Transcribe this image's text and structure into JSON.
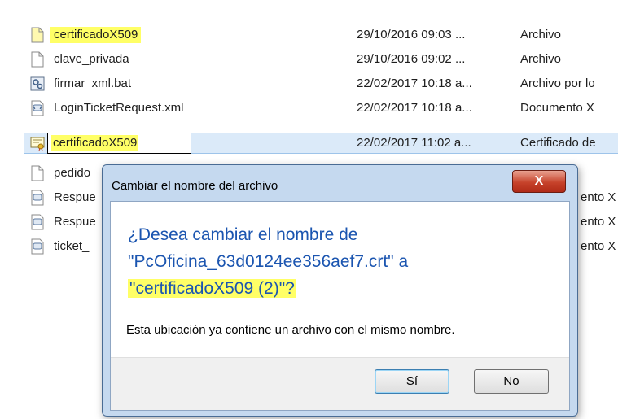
{
  "files": [
    {
      "name": "certificadoX509",
      "date": "29/10/2016 09:03 ...",
      "type": "Archivo",
      "icon": "blank-file-icon",
      "highlight": true
    },
    {
      "name": "clave_privada",
      "date": "29/10/2016 09:02 ...",
      "type": "Archivo",
      "icon": "blank-file-icon"
    },
    {
      "name": "firmar_xml.bat",
      "date": "22/02/2017 10:18 a...",
      "type": "Archivo por lo",
      "icon": "batch-file-icon"
    },
    {
      "name": "LoginTicketRequest.xml",
      "date": "22/02/2017 10:18 a...",
      "type": "Documento X",
      "icon": "xml-file-icon"
    },
    {
      "name": "certificadoX509",
      "date": "22/02/2017 11:02 a...",
      "type": "Certificado de",
      "icon": "certificate-file-icon",
      "selected": true
    },
    {
      "name": "pedido",
      "date": "",
      "type": "",
      "icon": "blank-file-icon"
    },
    {
      "name": "Respue",
      "date": "",
      "type": "ento X",
      "icon": "xml-file-icon"
    },
    {
      "name": "Respue",
      "date": "",
      "type": "ento X",
      "icon": "xml-file-icon"
    },
    {
      "name": "ticket_",
      "date": "",
      "type": "ento X",
      "icon": "xml-file-icon"
    }
  ],
  "dialog": {
    "title": "Cambiar el nombre del archivo",
    "close_label": "X",
    "question_line1": "¿Desea cambiar el nombre de",
    "question_line2": "\"PcOficina_63d0124ee356aef7.crt\" a",
    "question_line3": "\"certificadoX509 (2)\"?",
    "message": "Esta ubicación ya contiene un archivo con el mismo nombre.",
    "yes_label": "Sí",
    "no_label": "No"
  },
  "colors": {
    "highlight": "#ffff66",
    "question_text": "#1b55b0",
    "selection": "#dbeaf9"
  }
}
